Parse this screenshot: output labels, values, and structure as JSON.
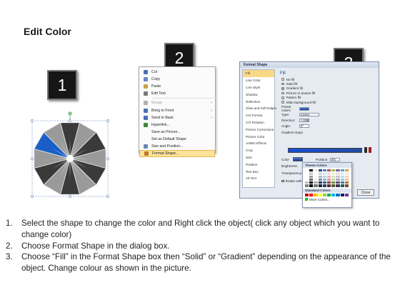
{
  "title": "Edit Color",
  "badges": [
    "1",
    "2",
    "3"
  ],
  "context_menu": {
    "items": [
      {
        "label": "Cut",
        "state": "normal",
        "icon": "scissors-icon",
        "color": "#4a6fb5"
      },
      {
        "label": "Copy",
        "state": "normal",
        "icon": "copy-icon",
        "color": "#6b86c0"
      },
      {
        "label": "Paste",
        "state": "normal",
        "icon": "paste-icon",
        "color": "#c9a349"
      },
      {
        "label": "Edit Text",
        "state": "normal",
        "icon": "text-icon",
        "color": "#7a7a7a"
      },
      {
        "label": "Group",
        "state": "disabled",
        "icon": "group-icon",
        "color": "#b0b0b0",
        "submenu": true
      },
      {
        "label": "Bring to Front",
        "state": "normal",
        "icon": "bring-front-icon",
        "color": "#4a6fb5",
        "submenu": true
      },
      {
        "label": "Send to Back",
        "state": "normal",
        "icon": "send-back-icon",
        "color": "#4a6fb5",
        "submenu": true
      },
      {
        "label": "Hyperlink...",
        "state": "normal",
        "icon": "hyperlink-icon",
        "color": "#3a8a3a"
      },
      {
        "label": "Save as Picture...",
        "state": "normal",
        "icon": "",
        "color": ""
      },
      {
        "label": "Set as Default Shape",
        "state": "normal",
        "icon": "",
        "color": ""
      },
      {
        "label": "Size and Position...",
        "state": "normal",
        "icon": "size-icon",
        "color": "#6a85b8"
      },
      {
        "label": "Format Shape...",
        "state": "highlighted",
        "icon": "format-shape-icon",
        "color": "#c07a2c"
      }
    ]
  },
  "dialog": {
    "title": "Format Shape",
    "sidebar": [
      "Fill",
      "Line Color",
      "Line Style",
      "Shadow",
      "Reflection",
      "Glow and Soft Edges",
      "3-D Format",
      "3-D Rotation",
      "Picture Corrections",
      "Picture Color",
      "Artistic Effects",
      "Crop",
      "Size",
      "Position",
      "Text Box",
      "Alt Text"
    ],
    "selected": "Fill",
    "pane_heading": "Fill",
    "options": [
      {
        "label": "No fill",
        "on": false
      },
      {
        "label": "Solid fill",
        "on": false
      },
      {
        "label": "Gradient fill",
        "on": true
      },
      {
        "label": "Picture or texture fill",
        "on": false
      },
      {
        "label": "Pattern fill",
        "on": false
      },
      {
        "label": "Slide background fill",
        "on": false
      }
    ],
    "fields": [
      {
        "label": "Preset colors:"
      },
      {
        "label": "Type:",
        "value": "Linear"
      },
      {
        "label": "Direction:"
      },
      {
        "label": "Angle:",
        "value": "0°"
      }
    ],
    "gradient_stops_label": "Gradient stops",
    "color_label": "Color",
    "position_label": "Position:",
    "position_value": "0%",
    "brightness_label": "Brightness:",
    "transparency_label": "Transparency:",
    "rotate_label": "Rotate with shape",
    "close_label": "Close"
  },
  "palette": {
    "theme_title": "Theme Colors",
    "standard_title": "Standard Colors",
    "more_label": "More Colors...",
    "theme_top": [
      "#ffffff",
      "#000000",
      "#eeece1",
      "#1f497d",
      "#4f81bd",
      "#c0504d",
      "#9bbb59",
      "#8064a2",
      "#4bacc6",
      "#f79646"
    ],
    "standard": [
      "#c00000",
      "#ff0000",
      "#ffc000",
      "#ffff00",
      "#92d050",
      "#00b050",
      "#00b0f0",
      "#0070c0",
      "#002060",
      "#7030a0"
    ]
  },
  "steps": [
    {
      "num": "1.",
      "text": "Select the shape to change the color and Right click the object( click any object which you want to change color)"
    },
    {
      "num": "2.",
      "text": "Choose Format Shape in the dialog box."
    },
    {
      "num": "3.",
      "text": "Choose “Fill” in the Format Shape box then “Solid” or “Gradient” depending on the appearance of the object. Change colour as shown in the picture."
    }
  ],
  "wheel_colors": {
    "highlight": "#1a5fc8",
    "dark": "#3a3a3a",
    "light": "#9a9a9a"
  }
}
